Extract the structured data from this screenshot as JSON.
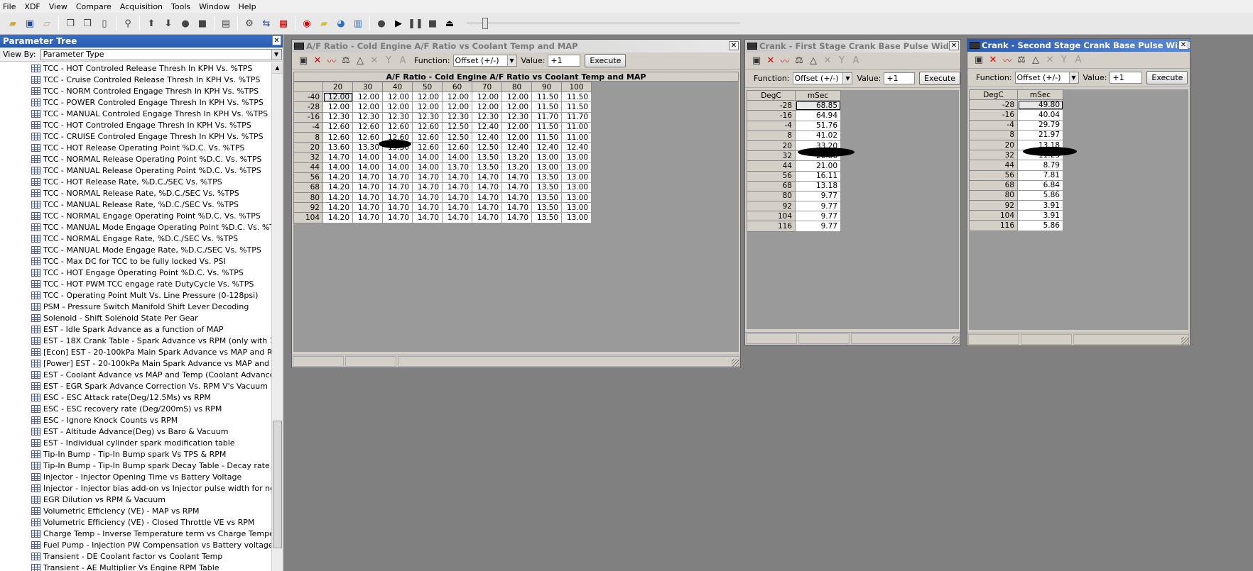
{
  "menu": [
    "File",
    "XDF",
    "View",
    "Compare",
    "Acquisition",
    "Tools",
    "Window",
    "Help"
  ],
  "param_tree": {
    "title": "Parameter Tree",
    "view_by_label": "View By:",
    "view_by_value": "Parameter Type",
    "items": [
      "TCC - HOT Controled Release Thresh In KPH Vs. %TPS",
      "TCC - Cruise Controled Release Thresh In KPH Vs. %TPS",
      "TCC - NORM Controled Engage Thresh In KPH Vs. %TPS",
      "TCC - POWER Controled Engage Thresh In KPH Vs. %TPS",
      "TCC - MANUAL Controled Engage Thresh In KPH Vs. %TPS",
      "TCC - HOT Controled Engage Thresh In KPH Vs. %TPS",
      "TCC - CRUISE Controled Engage Thresh In KPH Vs. %TPS",
      "TCC - HOT Release Operating Point %D.C. Vs. %TPS",
      "TCC - NORMAL Release Operating Point %D.C. Vs. %TPS",
      "TCC - MANUAL Release Operating Point %D.C. Vs. %TPS",
      "TCC - HOT Release Rate, %D.C./SEC Vs. %TPS",
      "TCC - NORMAL Release Rate,  %D.C./SEC Vs. %TPS",
      "TCC - MANUAL Release Rate,  %D.C./SEC Vs. %TPS",
      "TCC - NORMAL Engage Operating Point %D.C. Vs. %TPS",
      "TCC - MANUAL Mode Engage Operating Point %D.C. Vs. %TPS",
      "TCC - NORMAL Engage Rate,  %D.C./SEC Vs. %TPS",
      "TCC - MANUAL Mode Engage Rate,  %D.C./SEC Vs. %TPS",
      "TCC - Max DC for TCC to be fully locked Vs. PSI",
      "TCC - HOT Engage Operating Point %D.C. Vs. %TPS",
      "TCC - HOT PWM TCC engage rate DutyCycle Vs. %TPS",
      "TCC - Operating Point Mult Vs. Line Pressure (0-128psi)",
      "PSM - Pressure Switch Manifold Shift Lever Decoding",
      "Solenoid - Shift Solenoid State Per Gear",
      "EST - Idle Spark Advance as a function of MAP",
      "EST - 18X Crank Table - Spark Advance vs RPM (only with 18X)",
      "[Econ] EST - 20-100kPa Main Spark Advance vs MAP and RPM",
      "[Power] EST - 20-100kPa Main Spark Advance vs MAP and RPM",
      "EST - Coolant Advance vs MAP and Temp (Coolant Advance Bias Te",
      "EST - EGR Spark Advance Correction Vs. RPM V's Vacuum",
      "ESC - ESC Attack rate(Deg/12.5Ms) vs RPM",
      "ESC - ESC recovery rate (Deg/200mS) vs RPM",
      "ESC - Ignore Knock Counts vs RPM",
      "EST - Altitude Advance(Deg) vs Baro & Vacuum",
      "EST - Individual cylinder spark modification table",
      "Tip-In Bump - Tip-In Bump spark Vs TPS & RPM",
      "Tip-In Bump - Tip-In Bump spark Decay Table - Decay rate Vs TPS",
      "Injector - Injector Opening Time vs Battery Voltage",
      "Injector - Injector bias add-on vs Injector pulse width for non-linear",
      "EGR Dilution vs RPM & Vacuum",
      "Volumetric Efficiency (VE) - MAP vs RPM",
      "Volumetric Efficiency (VE) - Closed Throttle VE vs RPM",
      "Charge Temp - Inverse Temperature term vs Charge Temperature t",
      "Fuel Pump - Injection PW Compensation vs Battery voltage",
      "Transient - DE Coolant factor vs Coolant Temp",
      "Transient - AE Multiplier Vs Engine RPM Table"
    ]
  },
  "af_window": {
    "title": "A/F Ratio - Cold Engine A/F Ratio vs Coolant Temp and MAP",
    "function_label": "Function:",
    "function_value": "Offset (+/-)",
    "value_label": "Value:",
    "value": "+1",
    "execute": "Execute",
    "table_title": "A/F Ratio - Cold Engine A/F Ratio vs Coolant Temp and MAP",
    "cols": [
      "20",
      "30",
      "40",
      "50",
      "60",
      "70",
      "80",
      "90",
      "100"
    ],
    "rows": [
      {
        "h": "-40",
        "v": [
          "12.00",
          "12.00",
          "12.00",
          "12.00",
          "12.00",
          "12.00",
          "12.00",
          "11.50",
          "11.50"
        ]
      },
      {
        "h": "-28",
        "v": [
          "12.00",
          "12.00",
          "12.00",
          "12.00",
          "12.00",
          "12.00",
          "12.00",
          "11.50",
          "11.50"
        ]
      },
      {
        "h": "-16",
        "v": [
          "12.30",
          "12.30",
          "12.30",
          "12.30",
          "12.30",
          "12.30",
          "12.30",
          "11.70",
          "11.70"
        ]
      },
      {
        "h": "-4",
        "v": [
          "12.60",
          "12.60",
          "12.60",
          "12.60",
          "12.50",
          "12.40",
          "12.00",
          "11.50",
          "11.00"
        ]
      },
      {
        "h": "8",
        "v": [
          "12.60",
          "12.60",
          "12.60",
          "12.60",
          "12.50",
          "12.40",
          "12.00",
          "11.50",
          "11.00"
        ]
      },
      {
        "h": "20",
        "v": [
          "13.60",
          "13.30",
          "13.30",
          "12.60",
          "12.60",
          "12.50",
          "12.40",
          "12.40",
          "12.40"
        ]
      },
      {
        "h": "32",
        "v": [
          "14.70",
          "14.00",
          "14.00",
          "14.00",
          "14.00",
          "13.50",
          "13.20",
          "13.00",
          "13.00"
        ]
      },
      {
        "h": "44",
        "v": [
          "14.00",
          "14.00",
          "14.00",
          "14.00",
          "13.70",
          "13.50",
          "13.20",
          "13.00",
          "13.00"
        ]
      },
      {
        "h": "56",
        "v": [
          "14.20",
          "14.70",
          "14.70",
          "14.70",
          "14.70",
          "14.70",
          "14.70",
          "13.50",
          "13.00"
        ]
      },
      {
        "h": "68",
        "v": [
          "14.20",
          "14.70",
          "14.70",
          "14.70",
          "14.70",
          "14.70",
          "14.70",
          "13.50",
          "13.00"
        ]
      },
      {
        "h": "80",
        "v": [
          "14.20",
          "14.70",
          "14.70",
          "14.70",
          "14.70",
          "14.70",
          "14.70",
          "13.50",
          "13.00"
        ]
      },
      {
        "h": "92",
        "v": [
          "14.20",
          "14.70",
          "14.70",
          "14.70",
          "14.70",
          "14.70",
          "14.70",
          "13.50",
          "13.00"
        ]
      },
      {
        "h": "104",
        "v": [
          "14.20",
          "14.70",
          "14.70",
          "14.70",
          "14.70",
          "14.70",
          "14.70",
          "13.50",
          "13.00"
        ]
      }
    ]
  },
  "crank1_window": {
    "title": "Crank - First Stage Crank Base Pulse Width v...",
    "function_label": "Function:",
    "function_value": "Offset (+/-)",
    "value_label": "Value:",
    "value": "+1",
    "execute": "Execute",
    "col_headers": [
      "DegC",
      "mSec"
    ],
    "rows": [
      {
        "h": "-28",
        "v": "68.85"
      },
      {
        "h": "-16",
        "v": "64.94"
      },
      {
        "h": "-4",
        "v": "51.76"
      },
      {
        "h": "8",
        "v": "41.02"
      },
      {
        "h": "20",
        "v": "33.20"
      },
      {
        "h": "32",
        "v": "26.86"
      },
      {
        "h": "44",
        "v": "21.00"
      },
      {
        "h": "56",
        "v": "16.11"
      },
      {
        "h": "68",
        "v": "13.18"
      },
      {
        "h": "80",
        "v": "9.77"
      },
      {
        "h": "92",
        "v": "9.77"
      },
      {
        "h": "104",
        "v": "9.77"
      },
      {
        "h": "116",
        "v": "9.77"
      }
    ]
  },
  "crank2_window": {
    "title": "Crank - Second Stage Crank Base Pulse Width ...",
    "function_label": "Function:",
    "function_value": "Offset (+/-)",
    "value_label": "Value:",
    "value": "+1",
    "execute": "Execute",
    "col_headers": [
      "DegC",
      "mSec"
    ],
    "rows": [
      {
        "h": "-28",
        "v": "49.80"
      },
      {
        "h": "-16",
        "v": "40.04"
      },
      {
        "h": "-4",
        "v": "29.79"
      },
      {
        "h": "8",
        "v": "21.97"
      },
      {
        "h": "20",
        "v": "13.18"
      },
      {
        "h": "32",
        "v": "11.23"
      },
      {
        "h": "44",
        "v": "8.79"
      },
      {
        "h": "56",
        "v": "7.81"
      },
      {
        "h": "68",
        "v": "6.84"
      },
      {
        "h": "80",
        "v": "5.86"
      },
      {
        "h": "92",
        "v": "3.91"
      },
      {
        "h": "104",
        "v": "3.91"
      },
      {
        "h": "116",
        "v": "5.86"
      }
    ]
  }
}
